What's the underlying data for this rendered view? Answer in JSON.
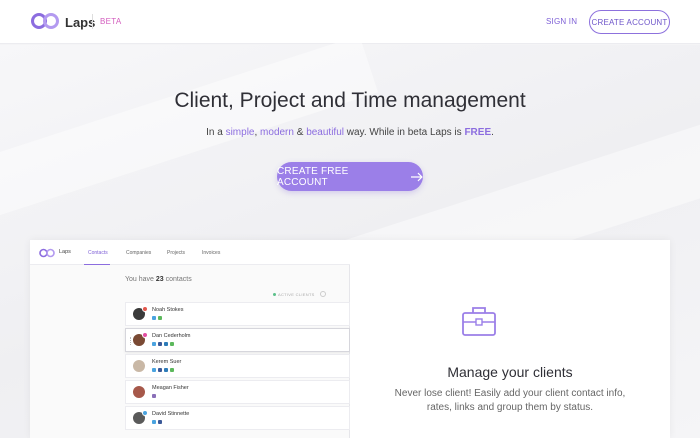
{
  "header": {
    "brand": "Laps",
    "beta": "BETA",
    "signin": "SIGN IN",
    "create_account": "CREATE ACCOUNT"
  },
  "hero": {
    "title": "Client, Project and Time management",
    "sub_prefix": "In a ",
    "simple": "simple",
    "comma": ", ",
    "modern": "modern",
    "amp": " & ",
    "beautiful": "beautiful",
    "sub_mid": " way. While in beta Laps is ",
    "free": "FREE",
    "period": ".",
    "cta": "CREATE FREE ACCOUNT"
  },
  "preview": {
    "brand": "Laps",
    "tabs": [
      "Contacts",
      "Companies",
      "Projects",
      "Invoices"
    ],
    "count_prefix": "You have ",
    "count": "23",
    "count_suffix": " contacts",
    "active_label": "ACTIVE CLIENTS",
    "contacts": [
      {
        "name": "Noah Stokes"
      },
      {
        "name": "Dan Cederholm"
      },
      {
        "name": "Kerem Suer"
      },
      {
        "name": "Meagan Fisher"
      },
      {
        "name": "David Stinnette"
      }
    ]
  },
  "feature": {
    "title": "Manage your clients",
    "text": "Never lose client! Easily add your client contact info, rates, links and group them by status."
  },
  "colors": {
    "accent": "#9b7fe8",
    "beta": "#d35dbe"
  }
}
